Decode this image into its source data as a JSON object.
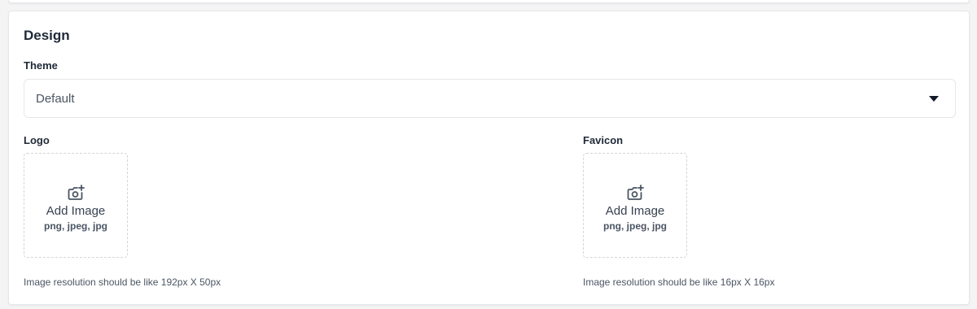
{
  "design": {
    "title": "Design",
    "theme": {
      "label": "Theme",
      "selected": "Default"
    },
    "logo": {
      "label": "Logo",
      "add_text": "Add Image",
      "types": "png, jpeg, jpg",
      "hint": "Image resolution should be like 192px X 50px"
    },
    "favicon": {
      "label": "Favicon",
      "add_text": "Add Image",
      "types": "png, jpeg, jpg",
      "hint": "Image resolution should be like 16px X 16px"
    }
  },
  "icons": {
    "upload": "camera-plus-icon",
    "select": "caret-down-icon"
  },
  "colors": {
    "background": "#f4f4f5",
    "card": "#ffffff",
    "border": "#e5e7eb",
    "text": "#1f2937",
    "muted": "#4b5563"
  }
}
